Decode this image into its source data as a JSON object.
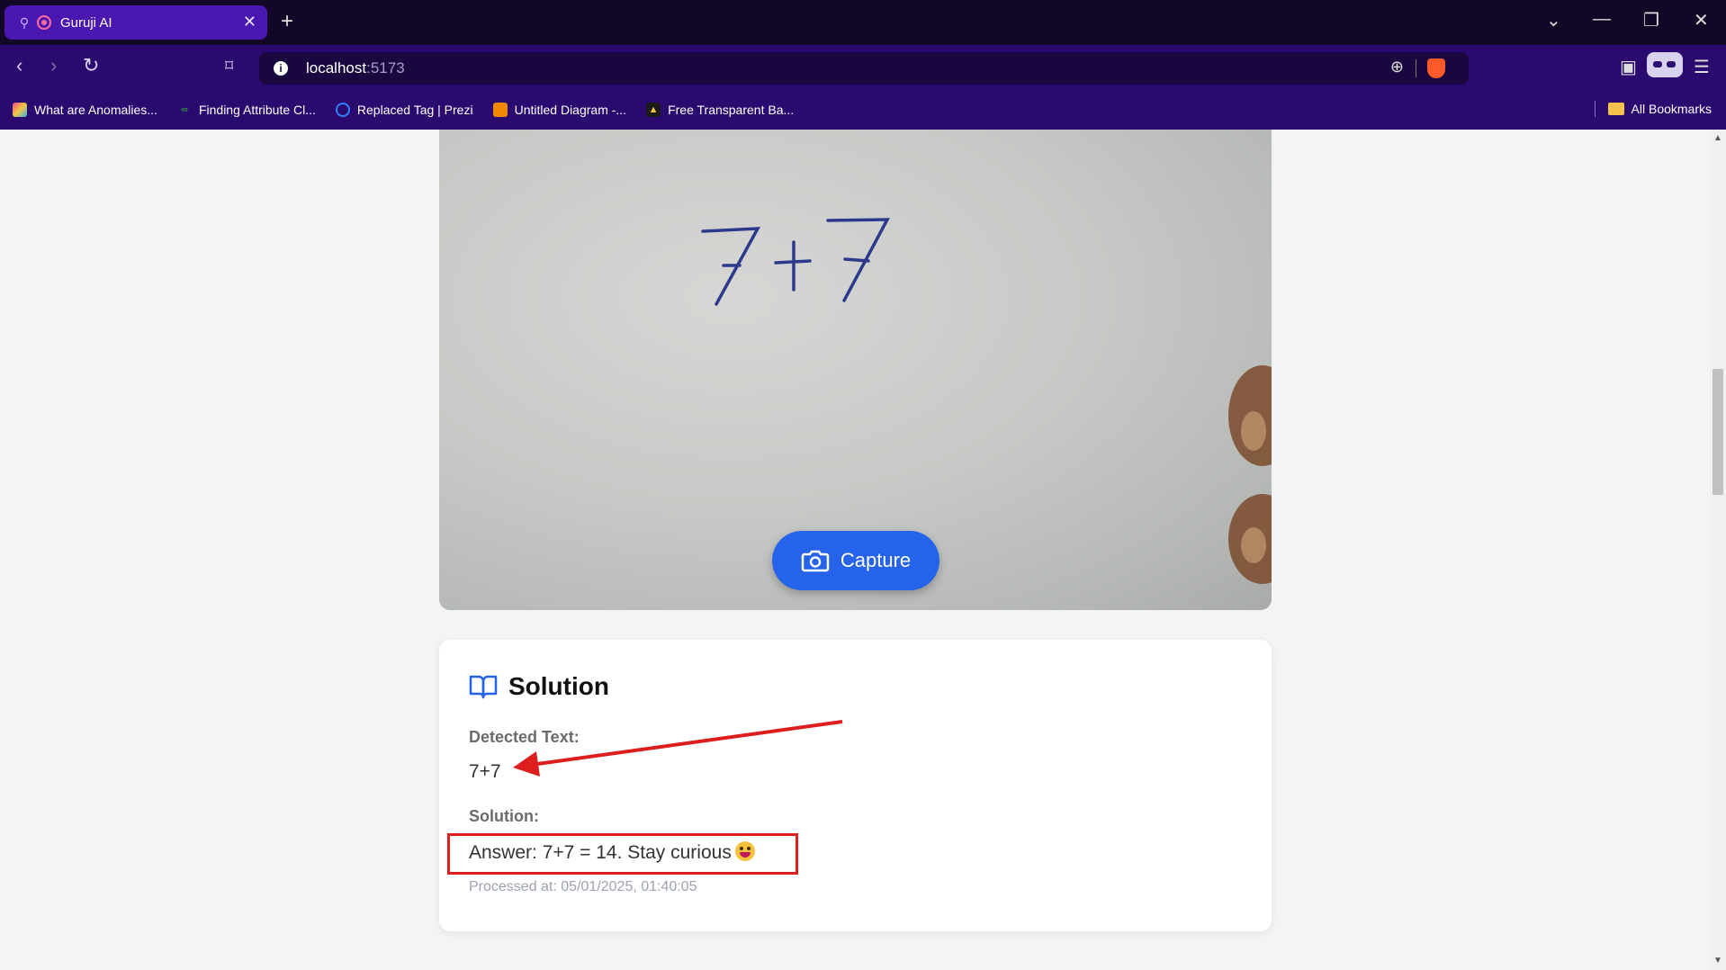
{
  "browser": {
    "tab_title": "Guruji AI",
    "url_host": "localhost",
    "url_port": ":5173",
    "bookmarks": [
      {
        "label": "What are Anomalies...",
        "icon": "colorful-grid-icon",
        "color": "#e94c89"
      },
      {
        "label": "Finding Attribute Cl...",
        "icon": "gfg-icon",
        "color": "#2f8d46"
      },
      {
        "label": "Replaced Tag | Prezi",
        "icon": "prezi-icon",
        "color": "#3181ff"
      },
      {
        "label": "Untitled Diagram -...",
        "icon": "drawio-icon",
        "color": "#f08705"
      },
      {
        "label": "Free Transparent Ba...",
        "icon": "triangle-logo-icon",
        "color": "#1a1a1a"
      }
    ],
    "all_bookmarks_label": "All Bookmarks"
  },
  "camera": {
    "capture_label": "Capture",
    "handwritten_text": "7+7"
  },
  "solution": {
    "title": "Solution",
    "detected_label": "Detected Text:",
    "detected_value": "7+7",
    "solution_label": "Solution:",
    "answer": "Answer: 7+7 = 14. Stay curious",
    "processed_at": "Processed at: 05/01/2025, 01:40:05"
  },
  "colors": {
    "accent": "#2563eb",
    "annotation_red": "#dc1e1e",
    "tab_bar": "#120726",
    "toolbar": "#2a0a6e"
  }
}
